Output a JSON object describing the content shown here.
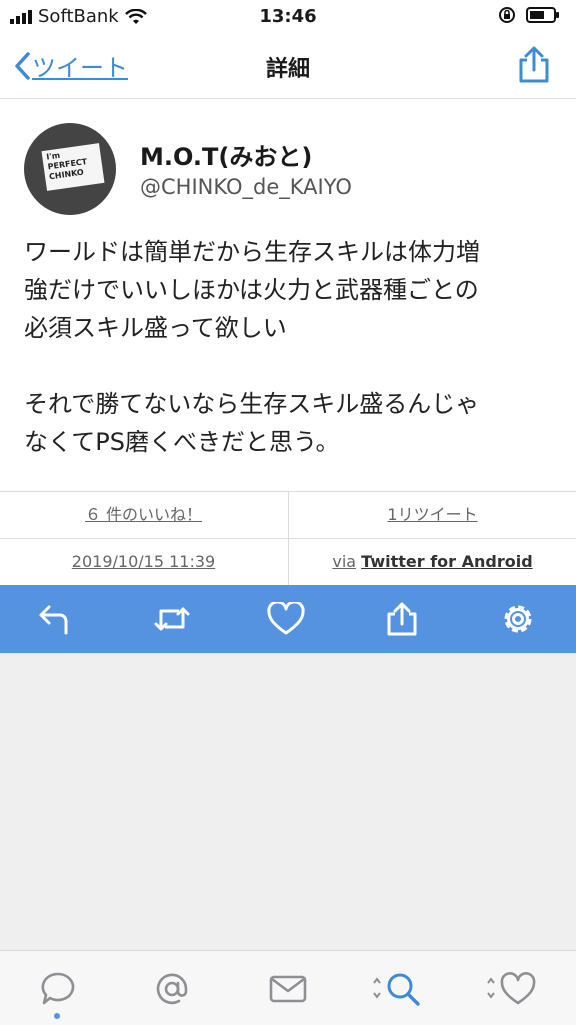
{
  "status_bar": {
    "carrier": "SoftBank",
    "time": "13:46"
  },
  "nav": {
    "back_label": "ツイート",
    "title": "詳細"
  },
  "tweet": {
    "display_name": "M.O.T(みおと)",
    "handle": "@CHINKO_de_KAIYO",
    "avatar_text": "I'm PERFECT CHINKO",
    "text": "ワールドは簡単だから生存スキルは体力増\n強だけでいいしほかは火力と武器種ごとの\n必須スキル盛って欲しい\n\nそれで勝てないなら生存スキル盛るんじゃ\nなくてPS磨くべきだと思う。"
  },
  "stats": {
    "likes": "６ 件のいいね！",
    "retweets": "1リツイート"
  },
  "meta": {
    "datetime": "2019/10/15 11:39",
    "via_prefix": "via",
    "via_client": "Twitter for Android"
  },
  "actions": [
    "reply-icon",
    "retweet-icon",
    "heart-icon",
    "share-icon",
    "gear-icon"
  ],
  "tabs": [
    "speech-bubble-icon",
    "mention-icon",
    "mail-icon",
    "search-icon",
    "heart-icon"
  ],
  "colors": {
    "accent": "#5593e0",
    "link": "#3d8bd6"
  }
}
